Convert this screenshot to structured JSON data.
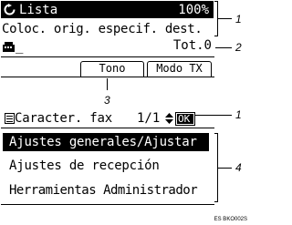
{
  "screen1": {
    "status_icon": "refresh-icon",
    "title": "Lista",
    "memory": "100%",
    "message": "Coloc. orig. especif. dest.",
    "line_icon": "fax-icon",
    "cursor": "_",
    "total": "Tot.0",
    "tabs": [
      "Tono",
      "Modo TX"
    ]
  },
  "screen2": {
    "menu_icon": "list-icon",
    "title": "Caracter. fax",
    "page": "1/1",
    "updown_icon": "up-down-icon",
    "ok": "OK",
    "items": [
      "Ajustes generales/Ajustar",
      "Ajustes de recepción",
      "Herramientas Administrador"
    ]
  },
  "callouts": [
    "1",
    "2",
    "3",
    "1",
    "4"
  ],
  "figure_code": "ES BKO002S"
}
